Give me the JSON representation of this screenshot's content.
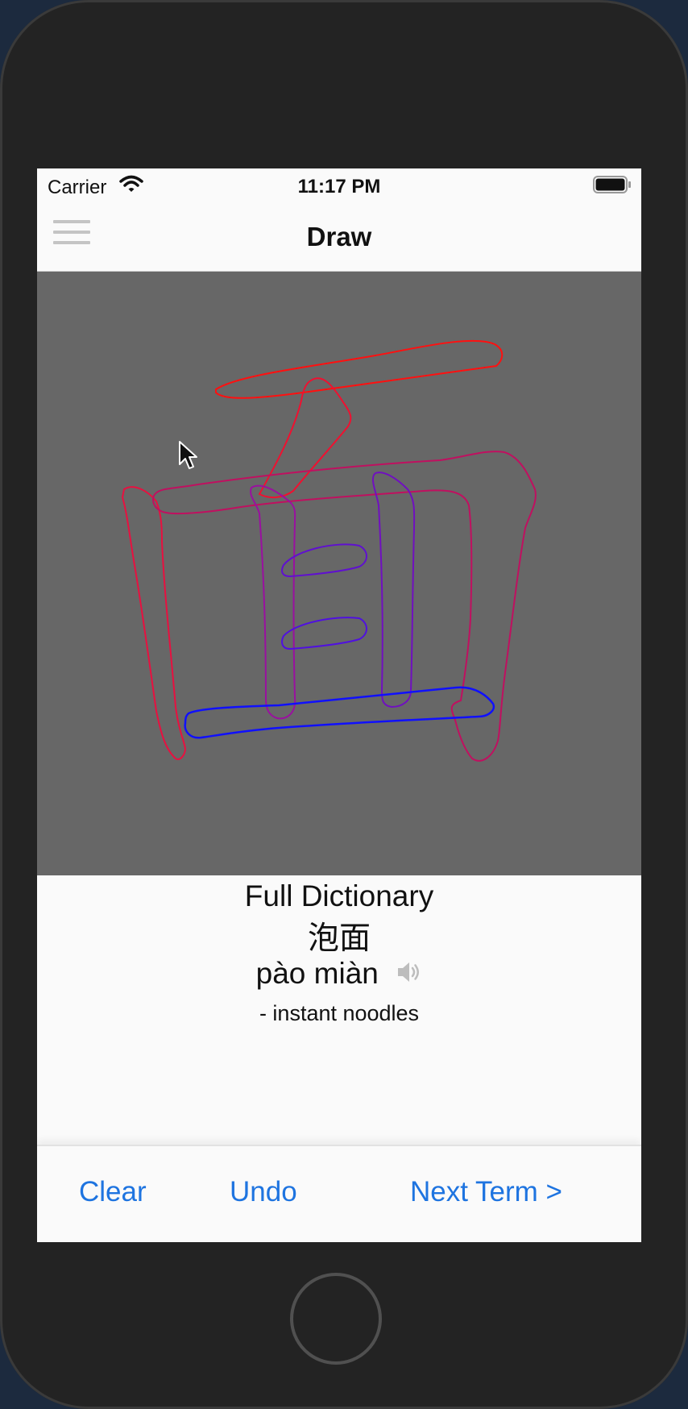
{
  "status_bar": {
    "carrier": "Carrier",
    "time": "11:17 PM"
  },
  "nav": {
    "title": "Draw"
  },
  "dictionary": {
    "source": "Full Dictionary",
    "characters": "泡面",
    "pinyin": "pào miàn",
    "definition": "- instant noodles"
  },
  "toolbar": {
    "clear_label": "Clear",
    "undo_label": "Undo",
    "next_label": "Next Term >"
  },
  "colors": {
    "accent": "#1e74e0",
    "canvas": "#676767",
    "stroke_start": "#ff0000",
    "stroke_end": "#0000ff"
  },
  "icons": {
    "menu": "hamburger-icon",
    "speaker": "speaker-icon",
    "wifi": "wifi-icon",
    "battery": "battery-icon",
    "cursor": "pointer-cursor-icon"
  }
}
